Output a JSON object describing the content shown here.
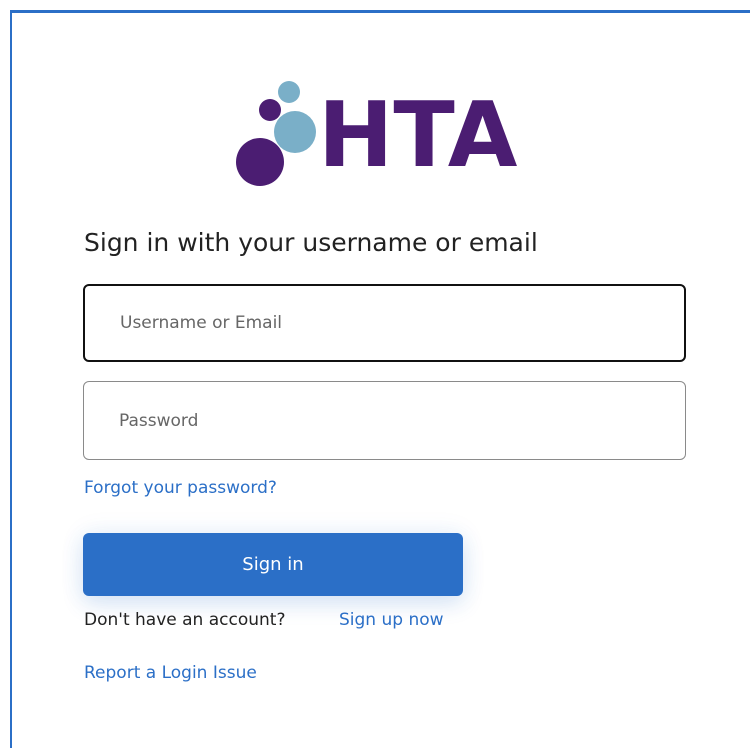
{
  "logo": {
    "brand_text": "HTA",
    "colors": {
      "text": "#4b1d72",
      "circle_dark": "#4b1d72",
      "circle_light": "#7aafc8"
    }
  },
  "form": {
    "heading": "Sign in with your username or email",
    "username_placeholder": "Username or Email",
    "password_placeholder": "Password",
    "forgot_link": "Forgot your password?",
    "signin_button": "Sign in",
    "no_account_text": "Don't have an account?",
    "signup_link": "Sign up now",
    "report_link": "Report a Login Issue"
  },
  "colors": {
    "accent": "#2b6fc7",
    "text": "#222222"
  }
}
